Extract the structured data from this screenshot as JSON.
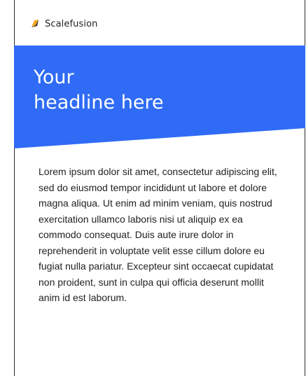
{
  "brand": {
    "name": "Scalefusion",
    "logo_icon": "scalefusion-logo-icon"
  },
  "hero": {
    "headline": "Your\nheadline here",
    "background_color": "#2F6BF5"
  },
  "content": {
    "paragraph": "Lorem ipsum dolor sit amet, consectetur adipiscing elit, sed do eiusmod tempor incididunt ut labore et dolore magna aliqua. Ut enim ad minim veniam, quis nostrud exercitation ullamco laboris nisi ut aliquip ex ea commodo consequat. Duis aute irure dolor in reprehenderit in voluptate velit esse cillum dolore eu fugiat nulla pariatur. Excepteur sint occaecat cupidatat non proident, sunt in culpa qui officia deserunt mollit anim id est laborum."
  }
}
